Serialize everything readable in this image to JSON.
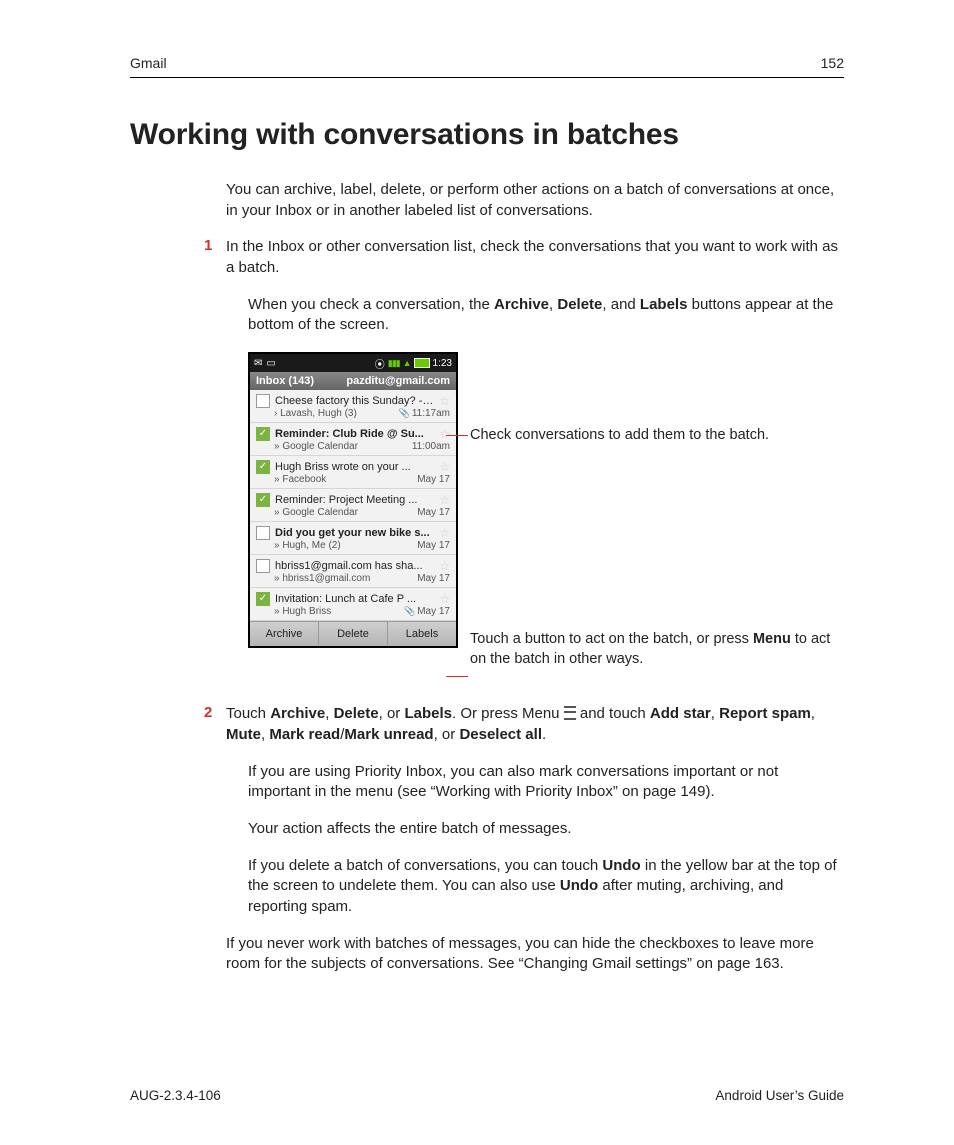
{
  "header": {
    "section": "Gmail",
    "page_number": "152"
  },
  "title": "Working with conversations in batches",
  "intro": "You can archive, label, delete, or perform other actions on a batch of conversations at once, in your Inbox or in another labeled list of conversations.",
  "steps": {
    "s1": {
      "num": "1",
      "text": "In the Inbox or other conversation list, check the conversations that you want to work with as a batch.",
      "sub_a": "When you check a conversation, the ",
      "sub_b": " buttons appear at the bottom of the screen.",
      "bold": {
        "archive": "Archive",
        "delete": "Delete",
        "labels": "Labels"
      },
      "comma": ", ",
      "and": ", and "
    },
    "s2": {
      "num": "2",
      "lead": "Touch ",
      "or_press": ". Or press Menu ",
      "and_touch": " and touch ",
      "list_sep": ", ",
      "or": ", or ",
      "period": ".",
      "slash": "/",
      "bold": {
        "archive": "Archive",
        "delete": "Delete",
        "labels": "Labels",
        "addstar": "Add star",
        "reportspam": "Report spam",
        "mute": "Mute",
        "markread": "Mark read",
        "markunread": "Mark unread",
        "deselect": "Deselect all"
      },
      "p2": "If you are using Priority Inbox, you can also mark conversations important or not important in the menu (see “Working with Priority Inbox” on page 149).",
      "p3": "Your action affects the entire batch of messages.",
      "p4a": "If you delete a batch of conversations, you can touch ",
      "p4b": " in the yellow bar at the top of the screen to undelete them. You can also use ",
      "p4c": " after muting, archiving, and reporting spam.",
      "undo": "Undo"
    }
  },
  "closing": "If you never work with batches of messages, you can hide the checkboxes to leave more room for the subjects of conversations. See “Changing Gmail settings” on page 163.",
  "phone": {
    "time": "1:23",
    "inbox_label": "Inbox (143)",
    "account": "pazditu@gmail.com",
    "buttons": {
      "archive": "Archive",
      "delete": "Delete",
      "labels": "Labels"
    },
    "items": [
      {
        "checked": false,
        "bold": false,
        "subject": "Cheese factory this Sunday? - ...",
        "from": "› Lavash, Hugh (3)",
        "time": "11:17am",
        "clip": true
      },
      {
        "checked": true,
        "bold": true,
        "subject": "Reminder: Club Ride @ Su...",
        "from": "» Google Calendar",
        "time": "11:00am",
        "clip": false
      },
      {
        "checked": true,
        "bold": false,
        "subject": "Hugh Briss wrote on your ...",
        "from": "» Facebook",
        "time": "May 17",
        "clip": false
      },
      {
        "checked": true,
        "bold": false,
        "subject": "Reminder: Project Meeting ...",
        "from": "» Google Calendar",
        "time": "May 17",
        "clip": false
      },
      {
        "checked": false,
        "bold": true,
        "subject": "Did you get your new bike s...",
        "from": "» Hugh, Me (2)",
        "time": "May 17",
        "clip": false
      },
      {
        "checked": false,
        "bold": false,
        "subject": "hbriss1@gmail.com has sha...",
        "from": "» hbriss1@gmail.com",
        "time": "May 17",
        "clip": false
      },
      {
        "checked": true,
        "bold": false,
        "subject": "Invitation: Lunch at Cafe P ...",
        "from": "» Hugh Briss",
        "time": "May 17",
        "clip": true
      }
    ]
  },
  "callouts": {
    "c1": "Check conversations to add them to the batch.",
    "c2a": "Touch a button to act on the batch, or press ",
    "c2_bold": "Menu",
    "c2b": " to act on the batch in other ways."
  },
  "footer": {
    "left": "AUG-2.3.4-106",
    "right": "Android User’s Guide"
  }
}
